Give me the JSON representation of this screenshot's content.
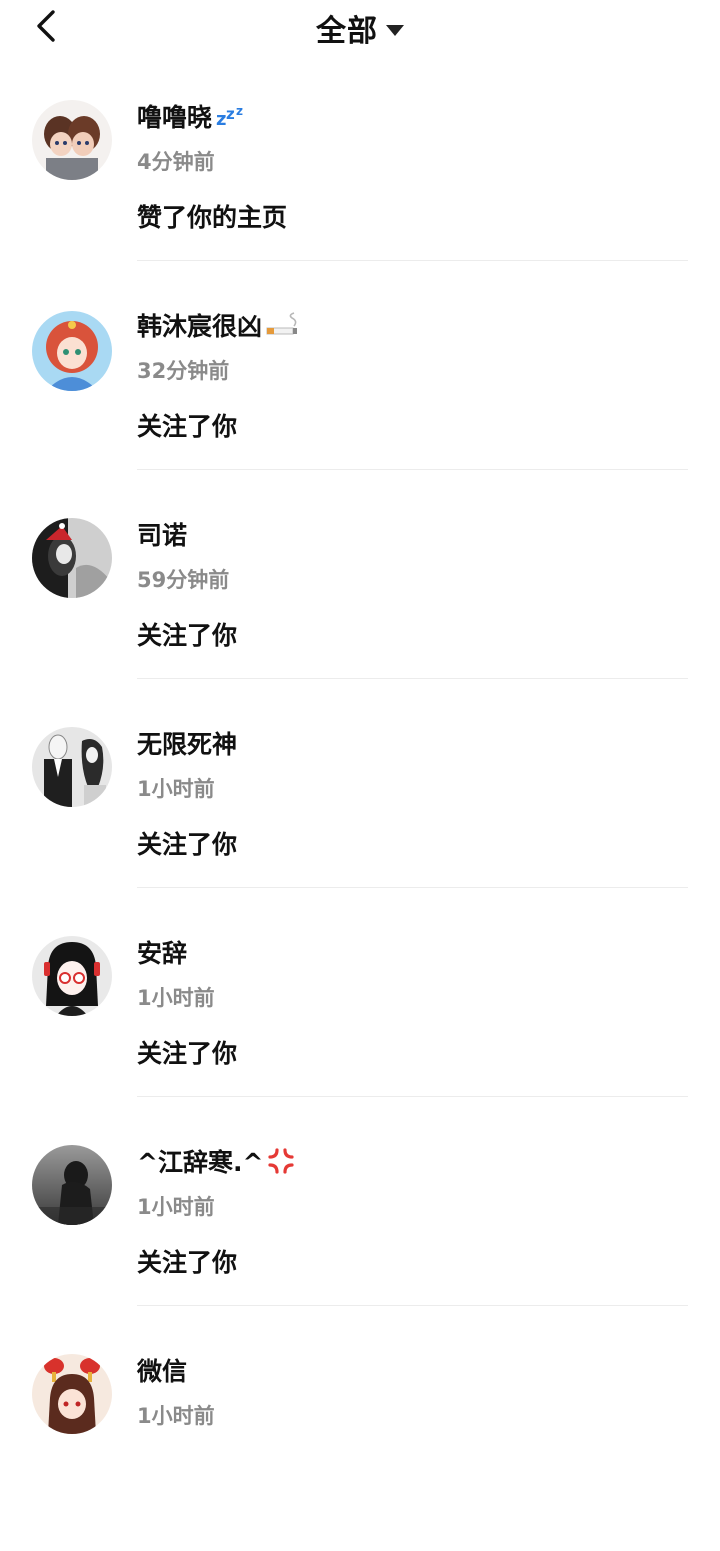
{
  "header": {
    "title": "全部",
    "back_icon": "chevron-left-icon",
    "filter_icon": "caret-down-icon"
  },
  "notifications": [
    {
      "name": "噜噜晓",
      "emoji": "zzz-icon",
      "time": "4分钟前",
      "action": "赞了你的主页"
    },
    {
      "name": "韩沐宸很凶",
      "emoji": "cigarette-icon",
      "time": "32分钟前",
      "action": "关注了你"
    },
    {
      "name": "司诺",
      "emoji": "",
      "time": "59分钟前",
      "action": "关注了你"
    },
    {
      "name": "无限死神",
      "emoji": "",
      "time": "1小时前",
      "action": "关注了你"
    },
    {
      "name": "安辞",
      "emoji": "",
      "time": "1小时前",
      "action": "关注了你"
    },
    {
      "name": "^江辞寒.^",
      "emoji": "anger-icon",
      "time": "1小时前",
      "action": "关注了你"
    },
    {
      "name": "微信",
      "emoji": "",
      "time": "1小时前",
      "action": ""
    }
  ]
}
